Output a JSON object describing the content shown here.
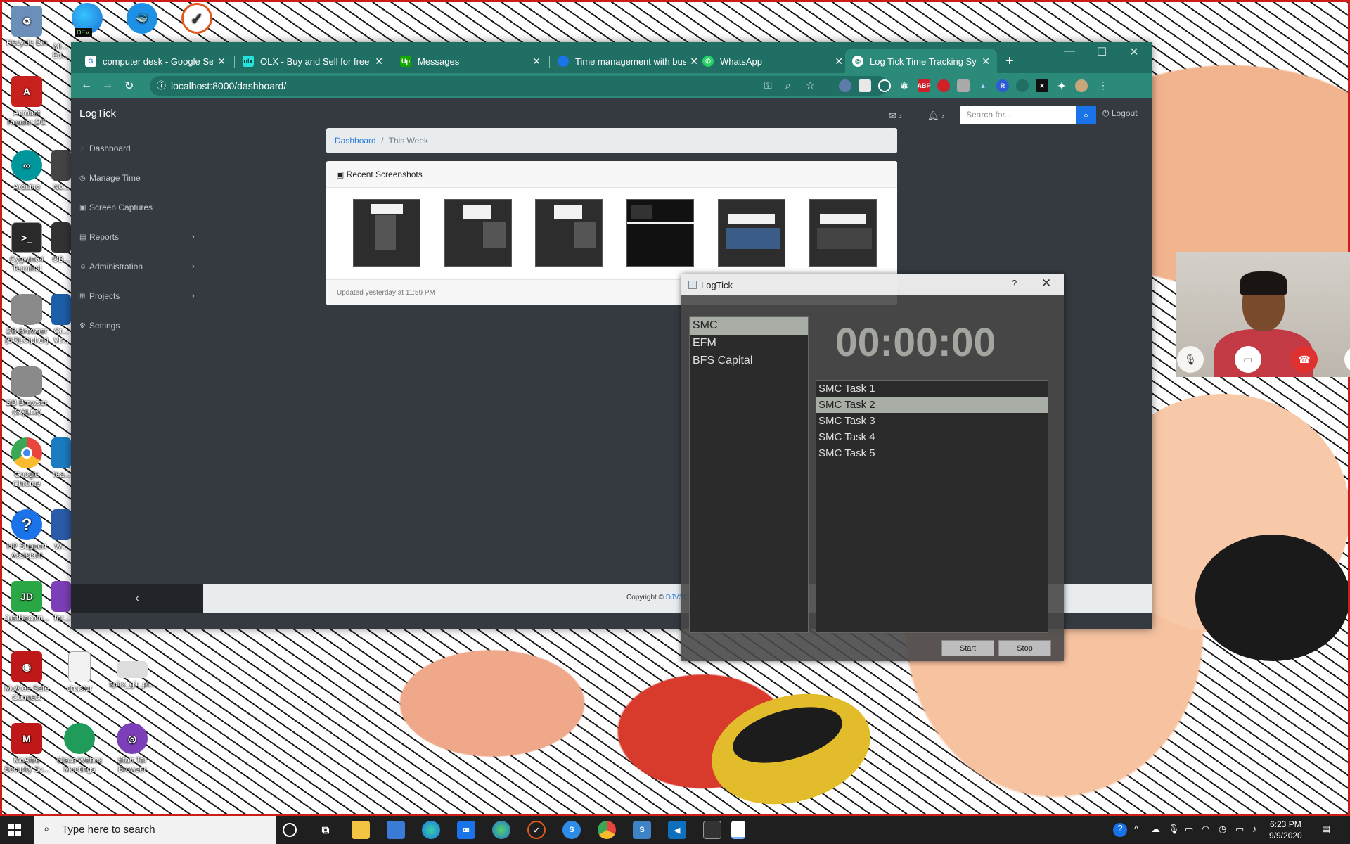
{
  "desktop": {
    "icons": [
      {
        "label": "Recycle Bin",
        "icon": "recycle-bin-icon",
        "color": "#6b8fb8"
      },
      {
        "label": "Acrobat Reader DC",
        "icon": "acrobat-icon",
        "color": "#c8201c"
      },
      {
        "label": "Arduino",
        "icon": "arduino-icon",
        "color": "#00979c"
      },
      {
        "label": "Cygwin64 Terminal",
        "icon": "terminal-icon",
        "color": "#2a2a2a"
      },
      {
        "label": "DB Browser (SQLCipher)",
        "icon": "database-icon",
        "color": "#8a8a8a"
      },
      {
        "label": "DB Browser (SQLite)",
        "icon": "database-icon",
        "color": "#8a8a8a"
      },
      {
        "label": "Google Chrome",
        "icon": "chrome-icon",
        "color": "#e8453c"
      },
      {
        "label": "HP Support Assistant",
        "icon": "hp-support-icon",
        "color": "#1a73e8"
      },
      {
        "label": "JustDecom...",
        "icon": "justdecompile-icon",
        "color": "#2aa845"
      },
      {
        "label": "McAfee Safe Connect",
        "icon": "mcafee-safe-connect-icon",
        "color": "#c01818"
      },
      {
        "label": "McAfee Security Sc...",
        "icon": "mcafee-icon",
        "color": "#c01818"
      },
      {
        "label": "chastor",
        "icon": "file-icon",
        "color": "#f2f2f2"
      },
      {
        "label": "sphx_glr_pl...",
        "icon": "image-file-icon",
        "color": "#dddddd"
      },
      {
        "label": "Cisco Webex Meetings",
        "icon": "webex-icon",
        "color": "#1f9c5a"
      },
      {
        "label": "Start Tor Browser",
        "icon": "tor-icon",
        "color": "#7d3fb8"
      },
      {
        "label": "Mi... Ed...",
        "icon": "edge-dev-icon",
        "color": "#2f8a5a"
      },
      {
        "label": "No...",
        "icon": "app-icon",
        "color": "#444444"
      },
      {
        "label": "OB...",
        "icon": "app-icon",
        "color": "#333333"
      },
      {
        "label": "Or... Vir...",
        "icon": "app-icon",
        "color": "#1c5ea8"
      },
      {
        "label": "Tea...",
        "icon": "app-icon",
        "color": "#1b7cc1"
      },
      {
        "label": "W...",
        "icon": "app-icon",
        "color": "#2a5ca8"
      },
      {
        "label": "Tor...",
        "icon": "app-icon",
        "color": "#7d3fb8"
      }
    ],
    "top_icons": [
      {
        "icon": "edge-dev-icon",
        "badge": "DEV"
      },
      {
        "icon": "docker-icon"
      },
      {
        "icon": "logtick-icon"
      }
    ]
  },
  "browser": {
    "tabs": [
      {
        "label": "computer desk - Google Sea",
        "icon": "google-icon",
        "active": false
      },
      {
        "label": "OLX - Buy and Sell for free a",
        "icon": "olx-icon",
        "active": false
      },
      {
        "label": "Messages",
        "icon": "upwork-icon",
        "active": false
      },
      {
        "label": "Time management with busi",
        "icon": "globe-icon",
        "active": false
      },
      {
        "label": "WhatsApp",
        "icon": "whatsapp-icon",
        "active": false
      },
      {
        "label": "Log Tick Time Tracking Syste",
        "icon": "globe-icon",
        "active": true
      }
    ],
    "url": "localhost:8000/dashboard/",
    "accent": "#2b8a7a"
  },
  "app": {
    "brand": "LogTick",
    "sidebar": [
      {
        "label": "Dashboard",
        "icon": "dashboard-icon",
        "has_arrow": false
      },
      {
        "label": "Manage Time",
        "icon": "clock-icon",
        "has_arrow": false
      },
      {
        "label": "Screen Captures",
        "icon": "camera-icon",
        "has_arrow": false
      },
      {
        "label": "Reports",
        "icon": "chart-icon",
        "has_arrow": true
      },
      {
        "label": "Administration",
        "icon": "users-icon",
        "has_arrow": true
      },
      {
        "label": "Projects",
        "icon": "sitemap-icon",
        "has_arrow": true
      },
      {
        "label": "Settings",
        "icon": "gear-icon",
        "has_arrow": false
      }
    ],
    "search_placeholder": "Search for...",
    "logout_label": "Logout",
    "breadcrumb": {
      "home": "Dashboard",
      "separator": "/",
      "current": "This Week"
    },
    "screenshots_card": {
      "title": "Recent Screenshots",
      "updated": "Updated yesterday at 11:59 PM",
      "thumbnail_count": 6
    },
    "footer": {
      "copyright": "Copyright ©",
      "company": "DJVSOFT CONCEPTS",
      "collapse": "‹"
    }
  },
  "logtick_window": {
    "title": "LogTick",
    "help": "?",
    "close": "✕",
    "projects": [
      "SMC",
      "EFM",
      "BFS Capital"
    ],
    "selected_project": "SMC",
    "timer": "00:00:00",
    "tasks": [
      "SMC Task 1",
      "SMC Task 2",
      "SMC Task 3",
      "SMC Task 4",
      "SMC Task 5"
    ],
    "selected_task": "SMC Task 2",
    "start_label": "Start",
    "stop_label": "Stop"
  },
  "taskbar": {
    "search_placeholder": "Type here to search",
    "time": "6:23 PM",
    "date": "9/9/2020",
    "apps": [
      "cortana-icon",
      "task-view-icon",
      "file-explorer-icon",
      "store-icon",
      "edge-icon",
      "mail-icon",
      "edge-dev-icon",
      "logtick-icon",
      "skype-icon",
      "chrome-icon",
      "sublime-icon",
      "vscode-icon",
      "terminal-icon",
      "notepad-icon"
    ]
  }
}
